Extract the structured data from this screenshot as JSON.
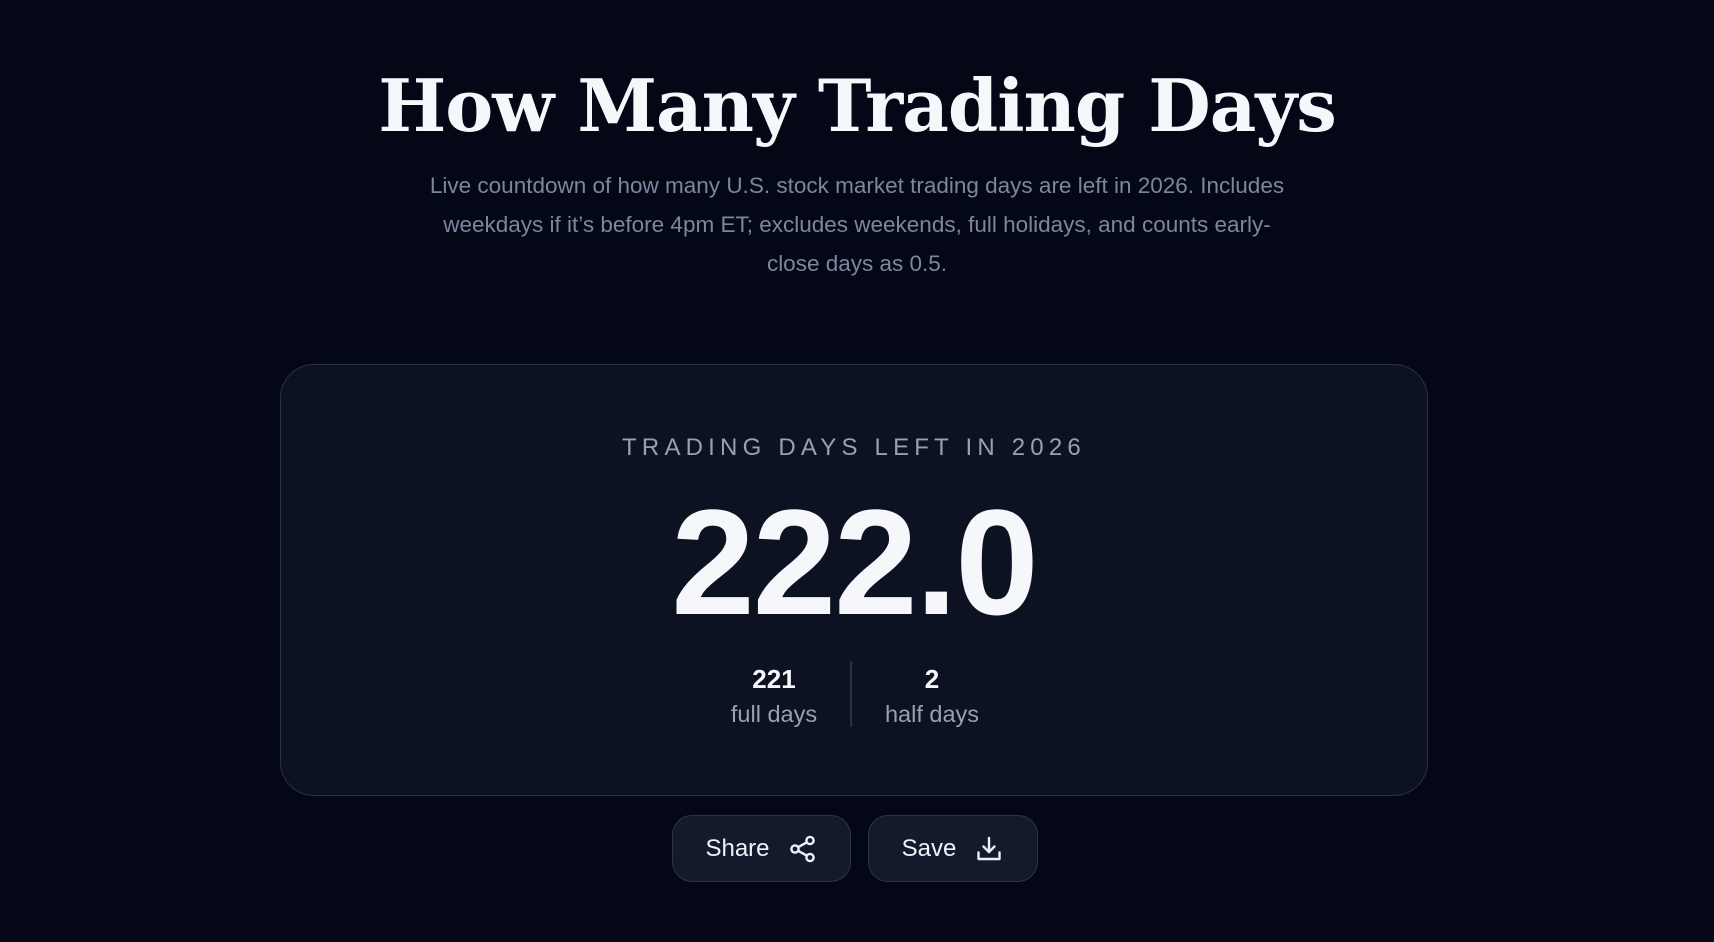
{
  "page": {
    "title": "How Many Trading Days",
    "subtitle": "Live countdown of how many U.S. stock market trading days are left in 2026. Includes weekdays if it’s before 4pm ET; excludes weekends, full holidays, and counts early-close days as 0.5."
  },
  "counter": {
    "label": "TRADING DAYS LEFT IN 2026",
    "value": "222.0",
    "full_days": {
      "value": "221",
      "unit": "full days"
    },
    "half_days": {
      "value": "2",
      "unit": "half days"
    }
  },
  "actions": {
    "share": {
      "label": "Share",
      "icon": "share-icon"
    },
    "save": {
      "label": "Save",
      "icon": "download-icon"
    }
  },
  "colors": {
    "background": "#040716",
    "card": "#0d1222",
    "muted_text": "#7b879f"
  }
}
